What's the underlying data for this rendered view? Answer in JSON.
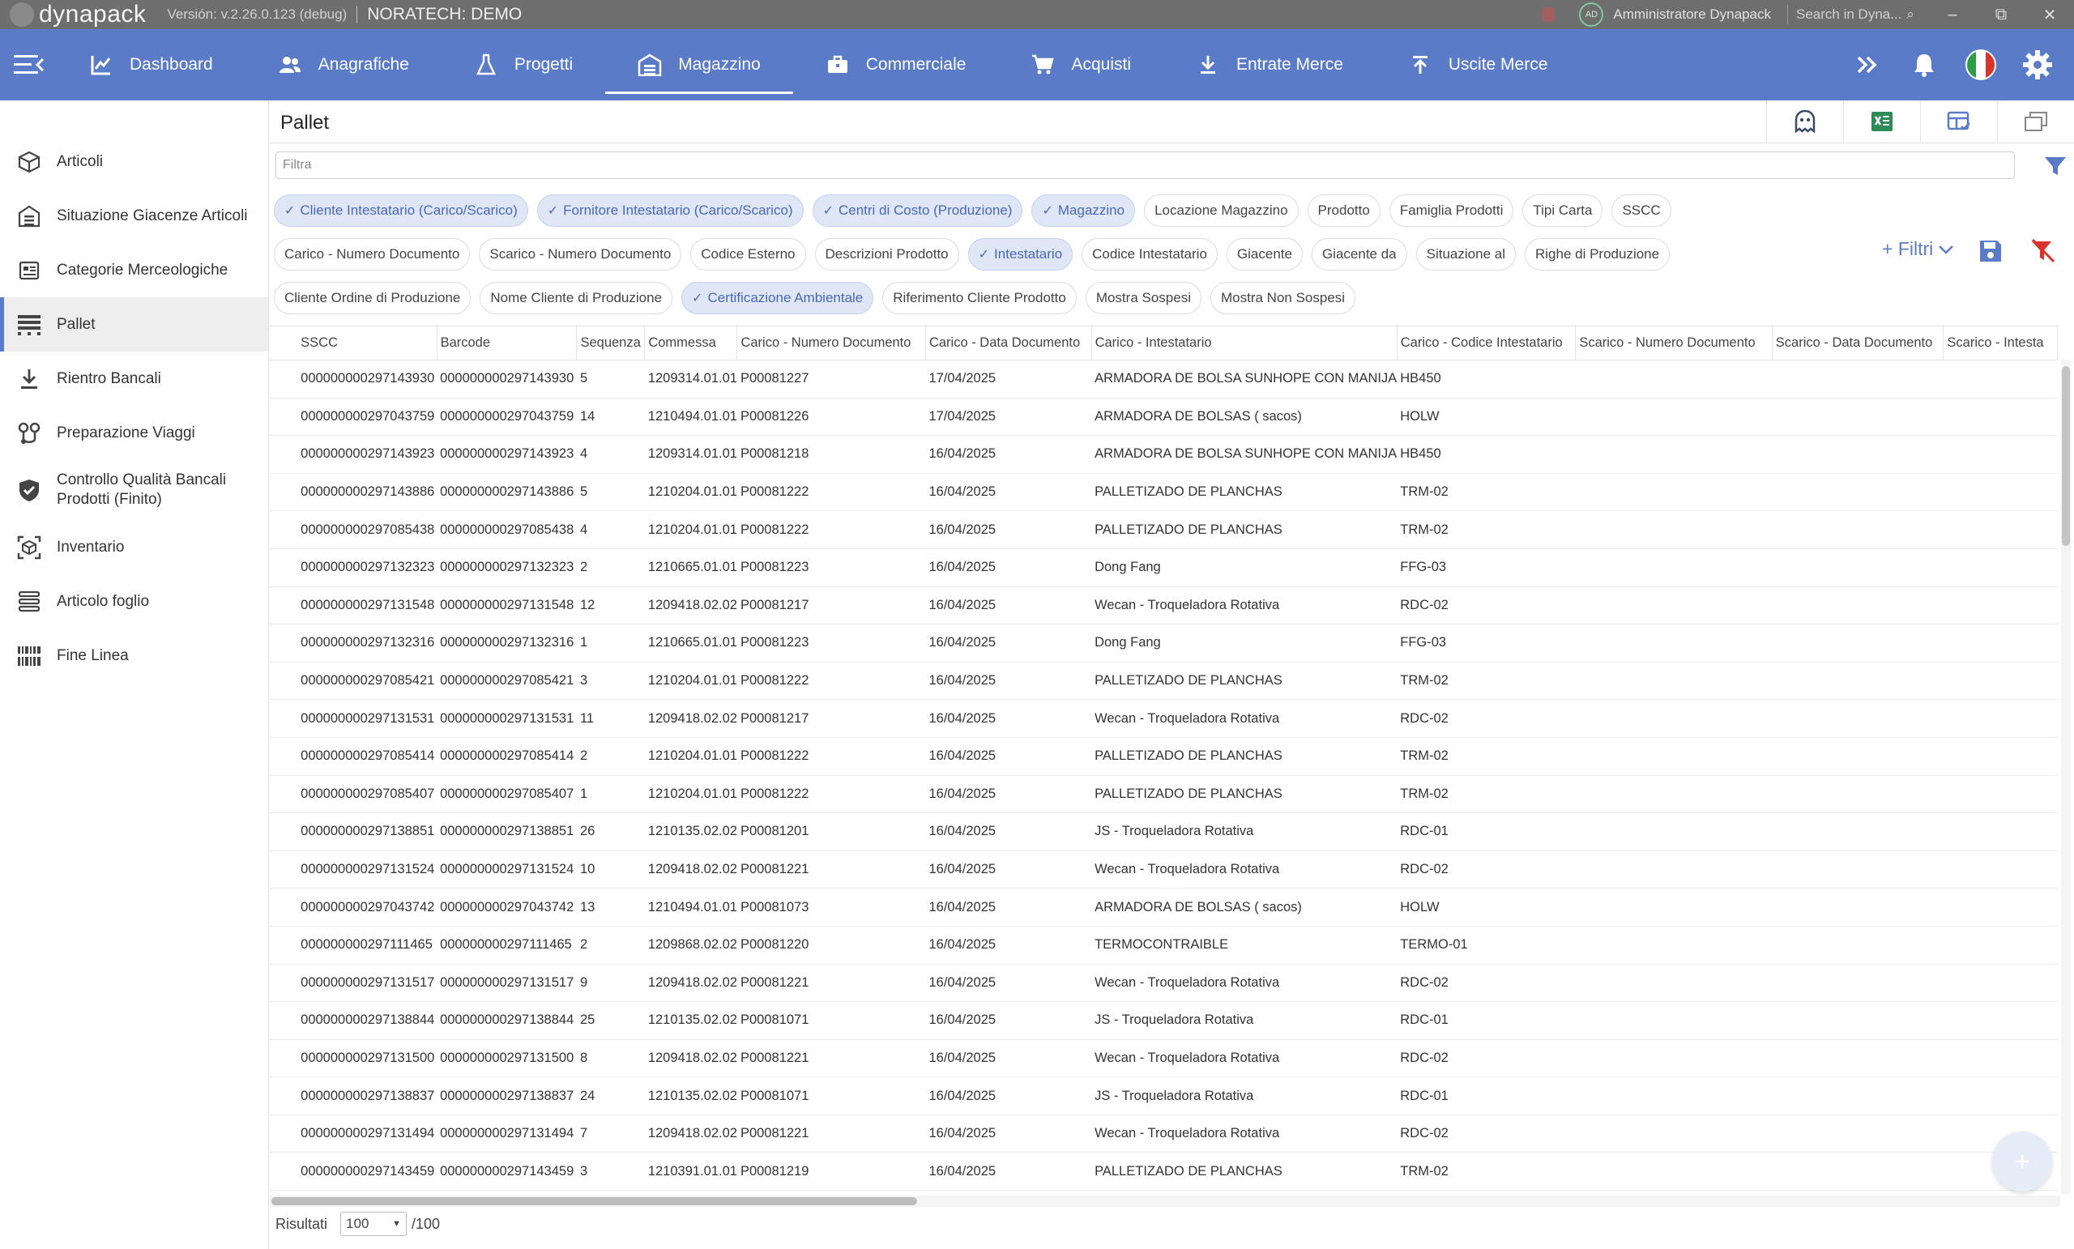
{
  "titlebar": {
    "brand": "dynapack",
    "version": "Versión: v.2.26.0.123 (debug)",
    "environment": "NORATECH: DEMO",
    "avatar_initials": "AD",
    "user": "Amministratore Dynapack",
    "search_placeholder": "Search in Dyna...",
    "minimize": "–",
    "restore": "⧉",
    "close": "✕"
  },
  "topnav": {
    "items": [
      {
        "label": "Dashboard",
        "icon": "chart-icon"
      },
      {
        "label": "Anagrafiche",
        "icon": "people-icon"
      },
      {
        "label": "Progetti",
        "icon": "flask-icon"
      },
      {
        "label": "Magazzino",
        "icon": "warehouse-icon",
        "active": true
      },
      {
        "label": "Commerciale",
        "icon": "briefcase-icon"
      },
      {
        "label": "Acquisti",
        "icon": "cart-icon"
      },
      {
        "label": "Entrate Merce",
        "icon": "download-icon"
      },
      {
        "label": "Uscite Merce",
        "icon": "upload-icon"
      }
    ],
    "more_icon": "chevron-double-right-icon",
    "accent": "#5a7bc7"
  },
  "sidebar": {
    "items": [
      {
        "label": "Articoli",
        "icon": "cube-icon"
      },
      {
        "label": "Situazione Giacenze Articoli",
        "icon": "building-icon"
      },
      {
        "label": "Categorie Merceologiche",
        "icon": "category-icon"
      },
      {
        "label": "Pallet",
        "icon": "pallet-icon",
        "active": true
      },
      {
        "label": "Rientro Bancali",
        "icon": "download-icon"
      },
      {
        "label": "Preparazione Viaggi",
        "icon": "route-icon"
      },
      {
        "label": "Controllo Qualità Bancali",
        "label2": "Prodotti (Finito)",
        "icon": "check-shield-icon"
      },
      {
        "label": "Inventario",
        "icon": "inventory-icon"
      },
      {
        "label": "Articolo foglio",
        "icon": "stack-icon"
      },
      {
        "label": "Fine Linea",
        "icon": "barcode-icon"
      }
    ]
  },
  "page": {
    "title": "Pallet",
    "filter_placeholder": "Filtra",
    "filtri_label": "+ Filtri"
  },
  "chips": {
    "row1": [
      {
        "label": "Cliente Intestatario (Carico/Scarico)",
        "selected": true
      },
      {
        "label": "Fornitore Intestatario (Carico/Scarico)",
        "selected": true
      },
      {
        "label": "Centri di Costo (Produzione)",
        "selected": true
      },
      {
        "label": "Magazzino",
        "selected": true
      },
      {
        "label": "Locazione Magazzino",
        "selected": false
      },
      {
        "label": "Prodotto",
        "selected": false
      },
      {
        "label": "Famiglia Prodotti",
        "selected": false
      },
      {
        "label": "Tipi Carta",
        "selected": false
      },
      {
        "label": "SSCC",
        "selected": false
      }
    ],
    "row2": [
      {
        "label": "Carico - Numero Documento",
        "selected": false
      },
      {
        "label": "Scarico - Numero Documento",
        "selected": false
      },
      {
        "label": "Codice Esterno",
        "selected": false
      },
      {
        "label": "Descrizioni Prodotto",
        "selected": false
      },
      {
        "label": "Intestatario",
        "selected": true
      },
      {
        "label": "Codice Intestatario",
        "selected": false
      },
      {
        "label": "Giacente",
        "selected": false
      },
      {
        "label": "Giacente da",
        "selected": false
      },
      {
        "label": "Situazione al",
        "selected": false
      },
      {
        "label": "Righe di Produzione",
        "selected": false
      }
    ],
    "row3": [
      {
        "label": "Cliente Ordine di Produzione",
        "selected": false
      },
      {
        "label": "Nome Cliente di Produzione",
        "selected": false
      },
      {
        "label": "Certificazione Ambientale",
        "selected": true
      },
      {
        "label": "Riferimento Cliente Prodotto",
        "selected": false
      },
      {
        "label": "Mostra Sospesi",
        "selected": false
      },
      {
        "label": "Mostra Non Sospesi",
        "selected": false
      }
    ]
  },
  "table": {
    "columns": [
      "SSCC",
      "Barcode",
      "Sequenza",
      "Commessa",
      "Carico - Numero Documento",
      "Carico - Data Documento",
      "Carico - Intestatario",
      "Carico - Codice Intestatario",
      "Scarico - Numero Documento",
      "Scarico - Data Documento",
      "Scarico - Intesta"
    ],
    "rows": [
      [
        "000000000297143930",
        "000000000297143930",
        "5",
        "1209314.01.01",
        "P00081227",
        "17/04/2025",
        "ARMADORA DE BOLSA SUNHOPE CON MANIJA",
        "HB450"
      ],
      [
        "000000000297043759",
        "000000000297043759",
        "14",
        "1210494.01.01",
        "P00081226",
        "17/04/2025",
        "ARMADORA DE BOLSAS ( sacos)",
        "HOLW"
      ],
      [
        "000000000297143923",
        "000000000297143923",
        "4",
        "1209314.01.01",
        "P00081218",
        "16/04/2025",
        "ARMADORA DE BOLSA SUNHOPE CON MANIJA",
        "HB450"
      ],
      [
        "000000000297143886",
        "000000000297143886",
        "5",
        "1210204.01.01",
        "P00081222",
        "16/04/2025",
        "PALLETIZADO DE PLANCHAS",
        "TRM-02"
      ],
      [
        "000000000297085438",
        "000000000297085438",
        "4",
        "1210204.01.01",
        "P00081222",
        "16/04/2025",
        "PALLETIZADO DE PLANCHAS",
        "TRM-02"
      ],
      [
        "000000000297132323",
        "000000000297132323",
        "2",
        "1210665.01.01",
        "P00081223",
        "16/04/2025",
        "Dong Fang",
        "FFG-03"
      ],
      [
        "000000000297131548",
        "000000000297131548",
        "12",
        "1209418.02.02",
        "P00081217",
        "16/04/2025",
        "Wecan - Troqueladora Rotativa",
        "RDC-02"
      ],
      [
        "000000000297132316",
        "000000000297132316",
        "1",
        "1210665.01.01",
        "P00081223",
        "16/04/2025",
        "Dong Fang",
        "FFG-03"
      ],
      [
        "000000000297085421",
        "000000000297085421",
        "3",
        "1210204.01.01",
        "P00081222",
        "16/04/2025",
        "PALLETIZADO DE PLANCHAS",
        "TRM-02"
      ],
      [
        "000000000297131531",
        "000000000297131531",
        "11",
        "1209418.02.02",
        "P00081217",
        "16/04/2025",
        "Wecan - Troqueladora Rotativa",
        "RDC-02"
      ],
      [
        "000000000297085414",
        "000000000297085414",
        "2",
        "1210204.01.01",
        "P00081222",
        "16/04/2025",
        "PALLETIZADO DE PLANCHAS",
        "TRM-02"
      ],
      [
        "000000000297085407",
        "000000000297085407",
        "1",
        "1210204.01.01",
        "P00081222",
        "16/04/2025",
        "PALLETIZADO DE PLANCHAS",
        "TRM-02"
      ],
      [
        "000000000297138851",
        "000000000297138851",
        "26",
        "1210135.02.02",
        "P00081201",
        "16/04/2025",
        "JS - Troqueladora Rotativa",
        "RDC-01"
      ],
      [
        "000000000297131524",
        "000000000297131524",
        "10",
        "1209418.02.02",
        "P00081221",
        "16/04/2025",
        "Wecan - Troqueladora Rotativa",
        "RDC-02"
      ],
      [
        "000000000297043742",
        "000000000297043742",
        "13",
        "1210494.01.01",
        "P00081073",
        "16/04/2025",
        "ARMADORA DE BOLSAS ( sacos)",
        "HOLW"
      ],
      [
        "000000000297111465",
        "000000000297111465",
        "2",
        "1209868.02.02",
        "P00081220",
        "16/04/2025",
        "TERMOCONTRAIBLE",
        "TERMO-01"
      ],
      [
        "000000000297131517",
        "000000000297131517",
        "9",
        "1209418.02.02",
        "P00081221",
        "16/04/2025",
        "Wecan - Troqueladora Rotativa",
        "RDC-02"
      ],
      [
        "000000000297138844",
        "000000000297138844",
        "25",
        "1210135.02.02",
        "P00081071",
        "16/04/2025",
        "JS - Troqueladora Rotativa",
        "RDC-01"
      ],
      [
        "000000000297131500",
        "000000000297131500",
        "8",
        "1209418.02.02",
        "P00081221",
        "16/04/2025",
        "Wecan - Troqueladora Rotativa",
        "RDC-02"
      ],
      [
        "000000000297138837",
        "000000000297138837",
        "24",
        "1210135.02.02",
        "P00081071",
        "16/04/2025",
        "JS - Troqueladora Rotativa",
        "RDC-01"
      ],
      [
        "000000000297131494",
        "000000000297131494",
        "7",
        "1209418.02.02",
        "P00081221",
        "16/04/2025",
        "Wecan - Troqueladora Rotativa",
        "RDC-02"
      ],
      [
        "000000000297143459",
        "000000000297143459",
        "3",
        "1210391.01.01",
        "P00081219",
        "16/04/2025",
        "PALLETIZADO DE PLANCHAS",
        "TRM-02"
      ]
    ]
  },
  "footer": {
    "results_label": "Risultati",
    "page_size": "100",
    "total": "/100"
  }
}
